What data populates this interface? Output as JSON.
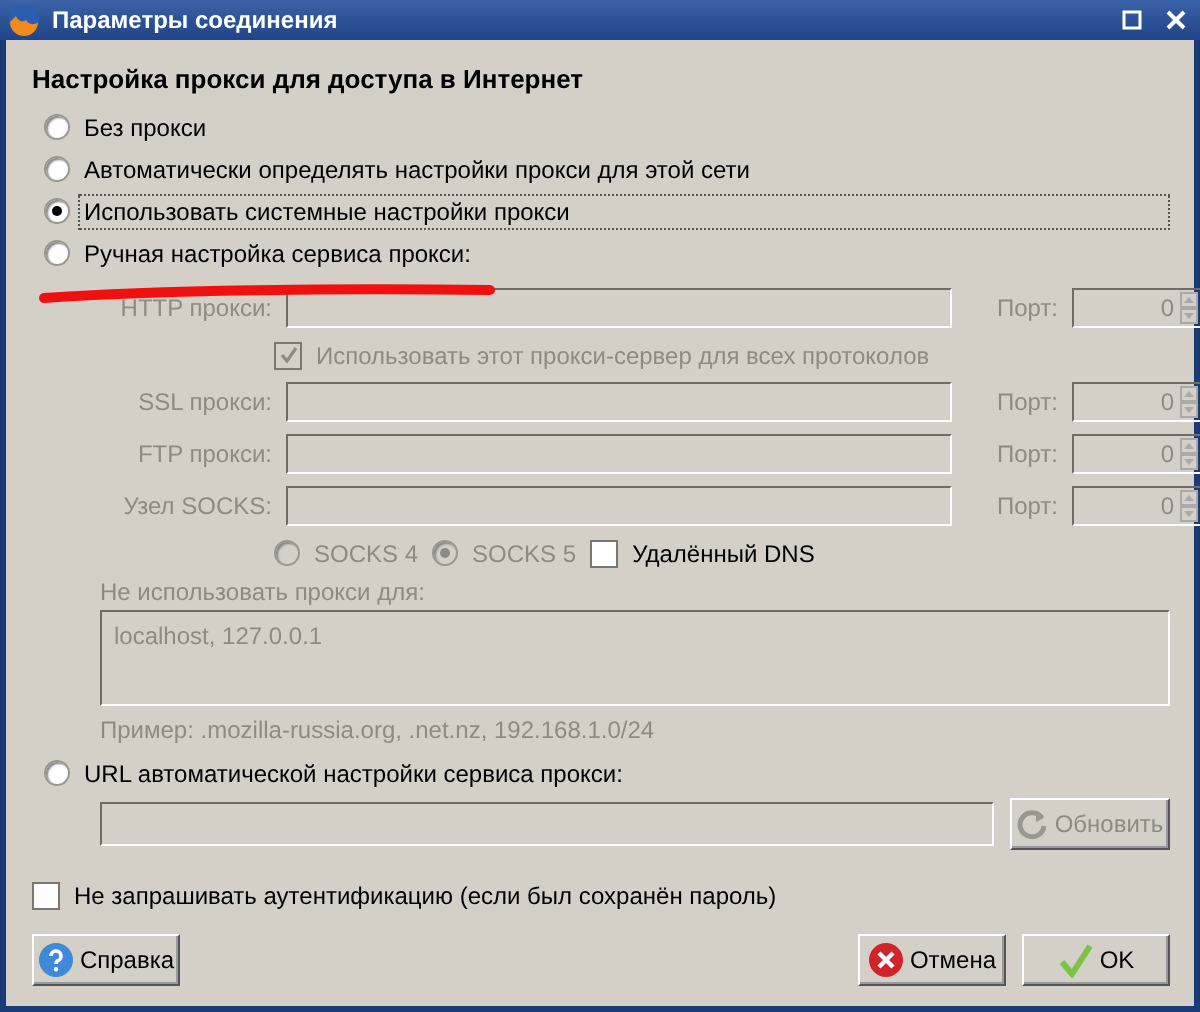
{
  "window": {
    "title": "Параметры соединения"
  },
  "heading": "Настройка прокси для доступа в Интернет",
  "modes": [
    {
      "label": "Без прокси",
      "selected": false,
      "focused": false
    },
    {
      "label": "Автоматически определять настройки прокси для этой сети",
      "selected": false,
      "focused": false
    },
    {
      "label": "Использовать системные настройки прокси",
      "selected": true,
      "focused": true
    },
    {
      "label": "Ручная настройка сервиса прокси:",
      "selected": false,
      "focused": false
    }
  ],
  "manual": {
    "disabled": true,
    "rows": [
      {
        "kind": "proxy",
        "label": "HTTP прокси:",
        "port_label": "Порт:",
        "port": "0"
      },
      {
        "kind": "share",
        "label": "Использовать этот прокси-сервер для всех протоколов",
        "checked": true
      },
      {
        "kind": "proxy",
        "label": "SSL прокси:",
        "port_label": "Порт:",
        "port": "0"
      },
      {
        "kind": "proxy",
        "label": "FTP прокси:",
        "port_label": "Порт:",
        "port": "0"
      },
      {
        "kind": "proxy",
        "label": "Узел SOCKS:",
        "port_label": "Порт:",
        "port": "0"
      }
    ],
    "socks_versions": [
      {
        "label": "SOCKS 4",
        "selected": false
      },
      {
        "label": "SOCKS 5",
        "selected": true
      }
    ],
    "remote_dns": {
      "label": "Удалённый DNS",
      "checked": false
    },
    "no_proxy_label": "Не использовать прокси для:",
    "no_proxy_value": "localhost, 127.0.0.1",
    "example": "Пример: .mozilla-russia.org, .net.nz, 192.168.1.0/24"
  },
  "auto_url": {
    "label": "URL автоматической настройки сервиса прокси:",
    "selected": false,
    "disabled": true,
    "refresh_button": "Обновить"
  },
  "no_auth": {
    "label": "Не запрашивать аутентификацию (если был сохранён пароль)",
    "checked": false
  },
  "buttons": [
    {
      "kind": "help",
      "label": "Справка"
    },
    {
      "kind": "cancel",
      "label": "Отмена"
    },
    {
      "kind": "ok",
      "label": "OK"
    }
  ]
}
